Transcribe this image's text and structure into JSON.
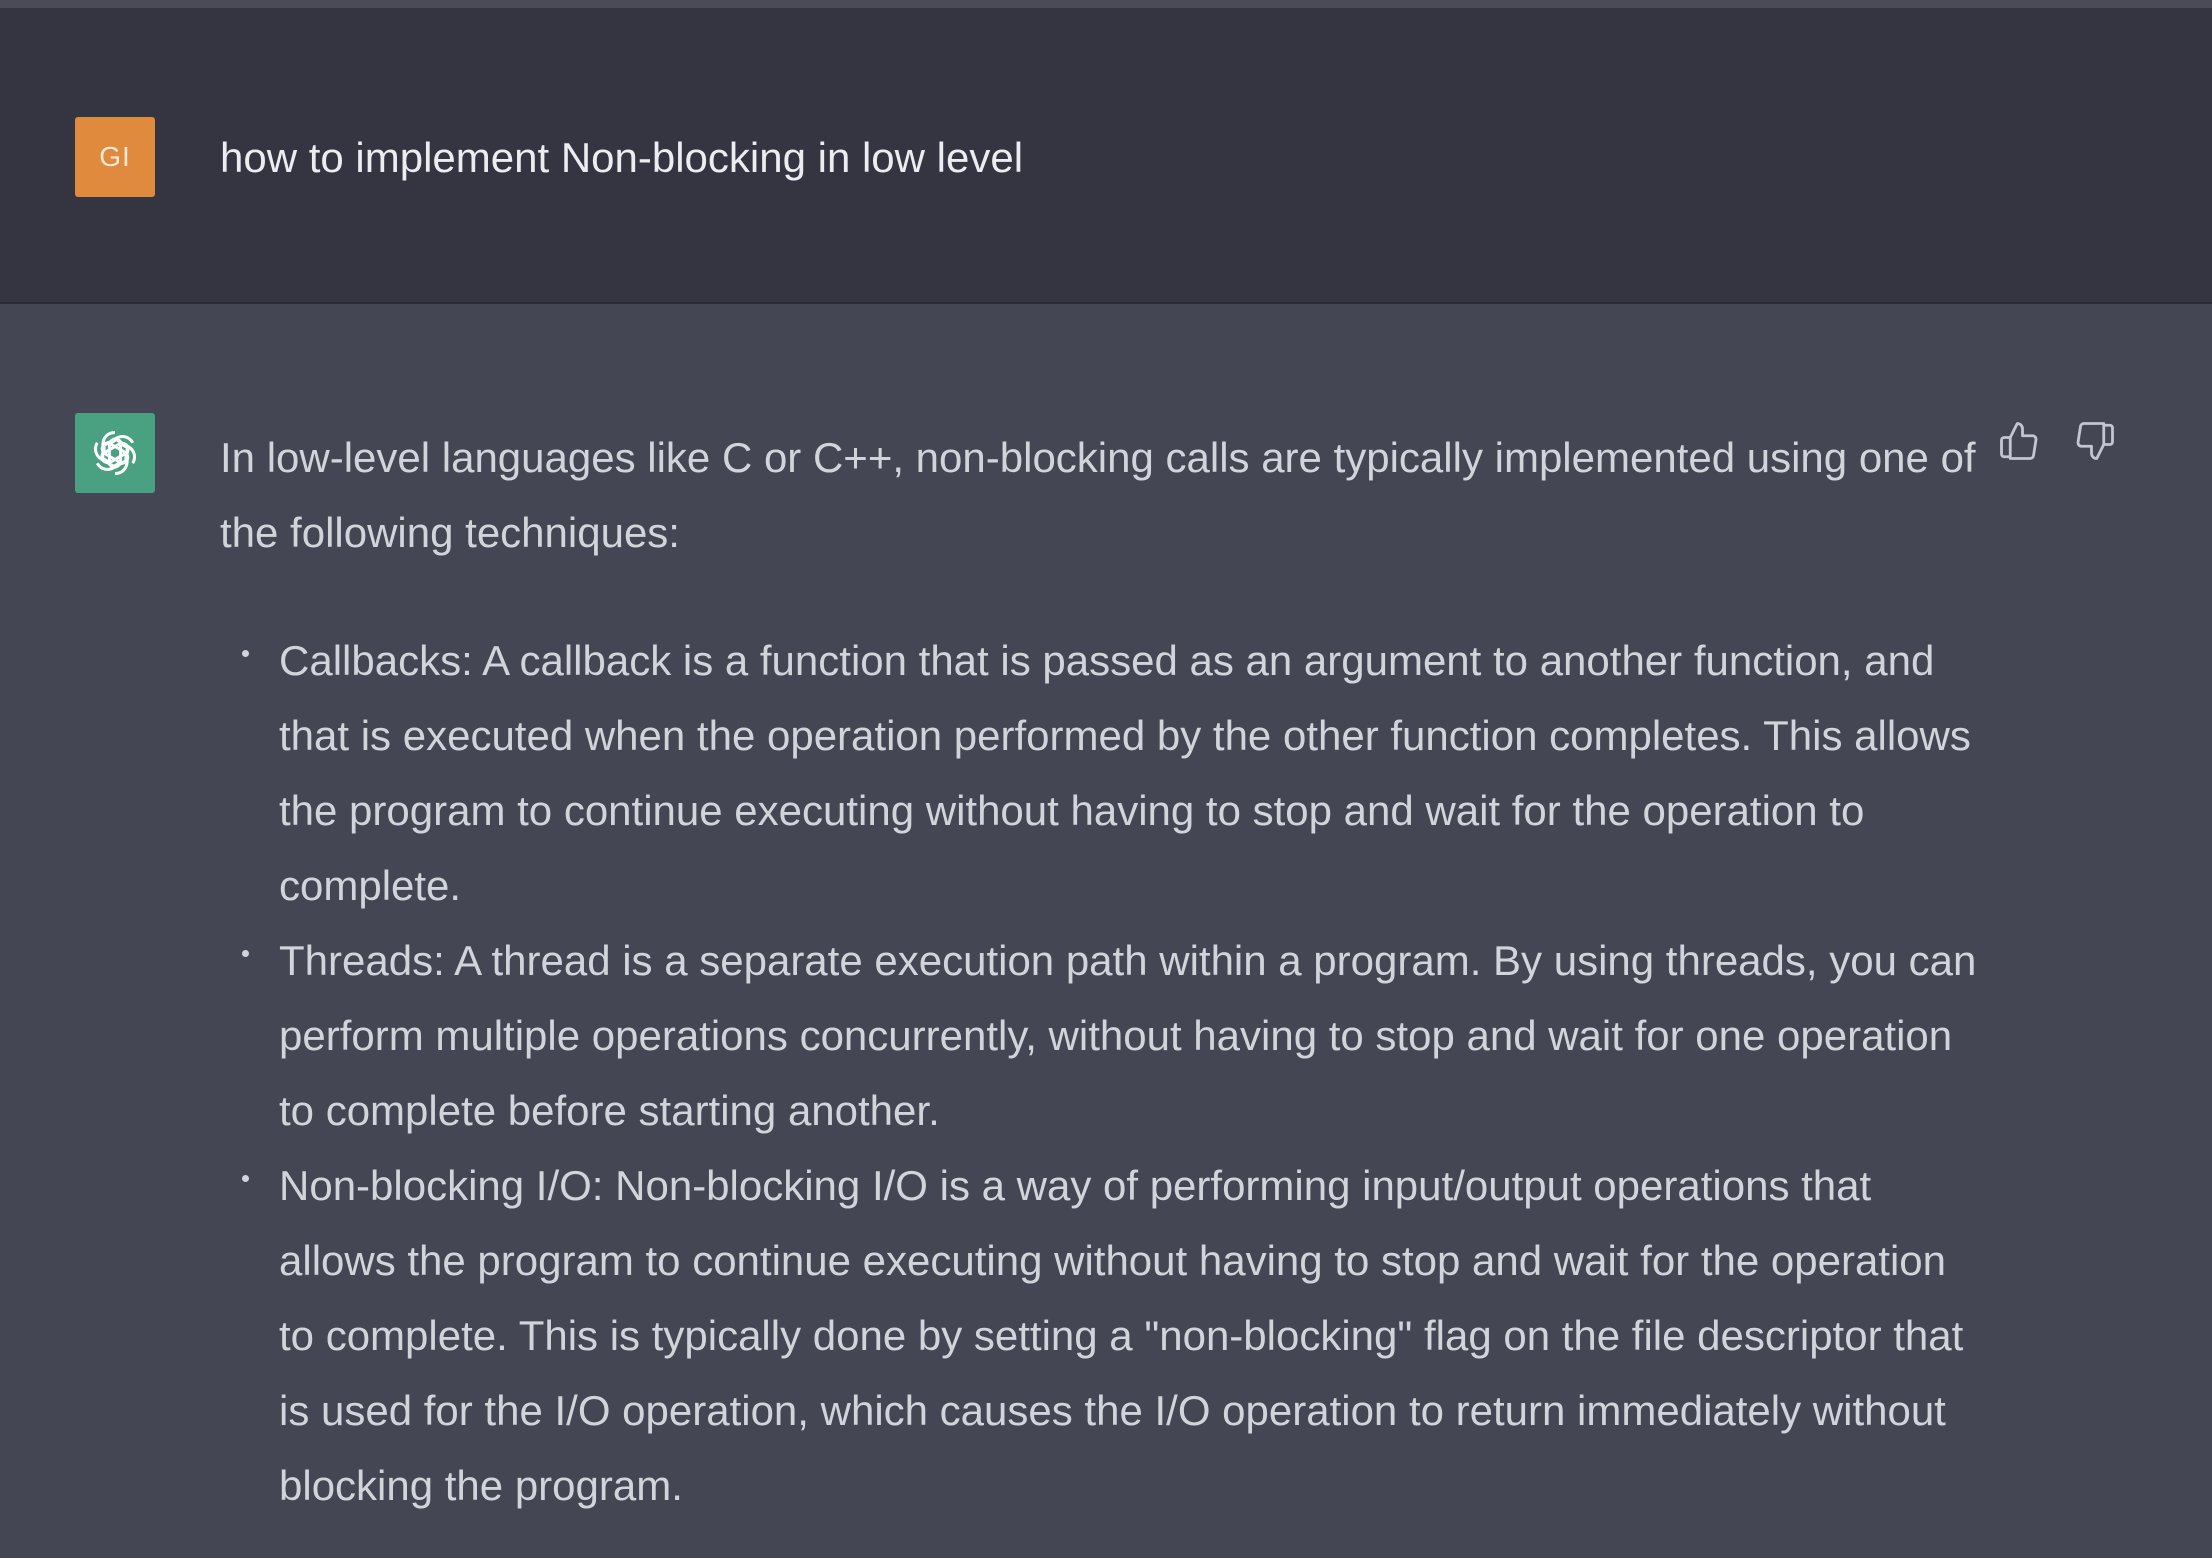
{
  "user_message": {
    "avatar_initials": "GI",
    "avatar_color": "#df8a3d",
    "text": "how to implement Non-blocking in low level"
  },
  "assistant_message": {
    "avatar_icon": "openai-logo-icon",
    "avatar_color": "#4aa181",
    "intro": "In low-level languages like C or C++, non-blocking calls are typically implemented using one of the following techniques:",
    "items": [
      {
        "text": "Callbacks: A callback is a function that is passed as an argument to another function, and that is executed when the operation performed by the other function completes. This allows the program to continue executing without having to stop and wait for the operation to complete."
      },
      {
        "text": "Threads: A thread is a separate execution path within a program. By using threads, you can perform multiple operations concurrently, without having to stop and wait for one operation to complete before starting another."
      },
      {
        "text": "Non-blocking I/O: Non-blocking I/O is a way of performing input/output operations that allows the program to continue executing without having to stop and wait for the operation to complete. This is typically done by setting a \"non-blocking\" flag on the file descriptor that is used for the I/O operation, which causes the I/O operation to return immediately without blocking the program."
      }
    ]
  },
  "feedback": {
    "thumbs_up_icon": "thumbs-up-icon",
    "thumbs_down_icon": "thumbs-down-icon"
  },
  "colors": {
    "user_bg": "#343541",
    "assistant_bg": "#444654",
    "text": "#d1d5db"
  }
}
